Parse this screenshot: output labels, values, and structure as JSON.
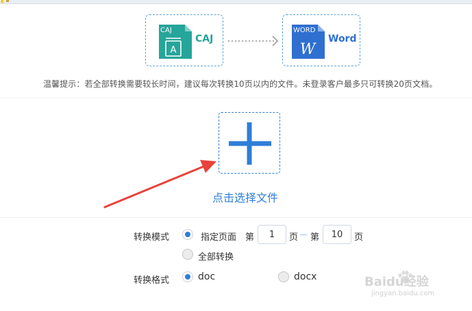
{
  "header": {
    "source_format": {
      "badge": "CAJ",
      "icon_letter": "A",
      "name": "CAJ",
      "color": "#26a59a"
    },
    "target_format": {
      "badge": "WORD",
      "icon_letter": "W",
      "name": "Word",
      "color": "#2f6fd0"
    },
    "tip": "温馨提示：若全部转换需要较长时间，建议每次转换10页以内的文件。未登录客户最多只可转换20页文档。"
  },
  "upload": {
    "label": "点击选择文件",
    "accent": "#2f7ed8"
  },
  "annotation": {
    "color": "#e8423a"
  },
  "options": {
    "mode": {
      "label": "转换模式",
      "specified_pages": {
        "label": "指定页面",
        "checked": true
      },
      "page_from_prefix": "第",
      "page_from": "1",
      "page_from_suffix": "页",
      "page_to_prefix": "第",
      "page_to": "10",
      "page_to_suffix": "页",
      "all": {
        "label": "全部转换",
        "checked": false
      }
    },
    "format": {
      "label": "转换格式",
      "choices": [
        {
          "label": "doc",
          "checked": true
        },
        {
          "label": "docx",
          "checked": false
        }
      ]
    }
  },
  "watermark": {
    "brand": "Baidu经验",
    "url": "jingyan.baidu.com"
  }
}
